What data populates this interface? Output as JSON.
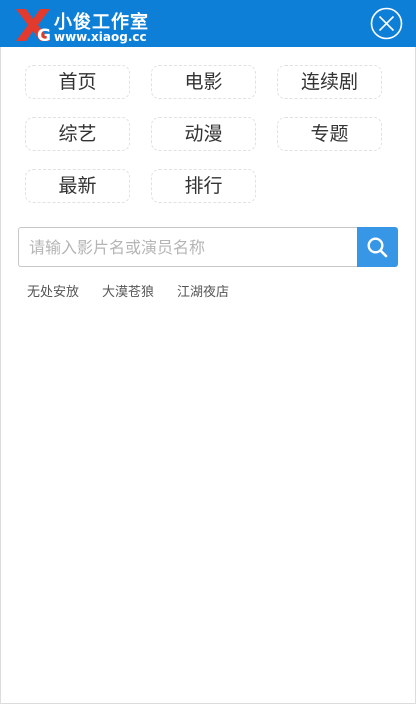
{
  "colors": {
    "header_bg": "#0e7fd6",
    "search_button_bg": "#3896e6",
    "logo_red": "#e23b2e"
  },
  "header": {
    "logo_letters": "XG",
    "logo_title": "小俊工作室",
    "logo_url": "www.xiaog.cc",
    "close_icon": "close-icon"
  },
  "nav": {
    "items": [
      {
        "label": "首页"
      },
      {
        "label": "电影"
      },
      {
        "label": "连续剧"
      },
      {
        "label": "综艺"
      },
      {
        "label": "动漫"
      },
      {
        "label": "专题"
      },
      {
        "label": "最新"
      },
      {
        "label": "排行"
      }
    ]
  },
  "search": {
    "placeholder": "请输入影片名或演员名称",
    "value": "",
    "button_icon": "search-icon"
  },
  "hot_keywords": [
    {
      "label": "无处安放"
    },
    {
      "label": "大漠苍狼"
    },
    {
      "label": "江湖夜店"
    }
  ]
}
